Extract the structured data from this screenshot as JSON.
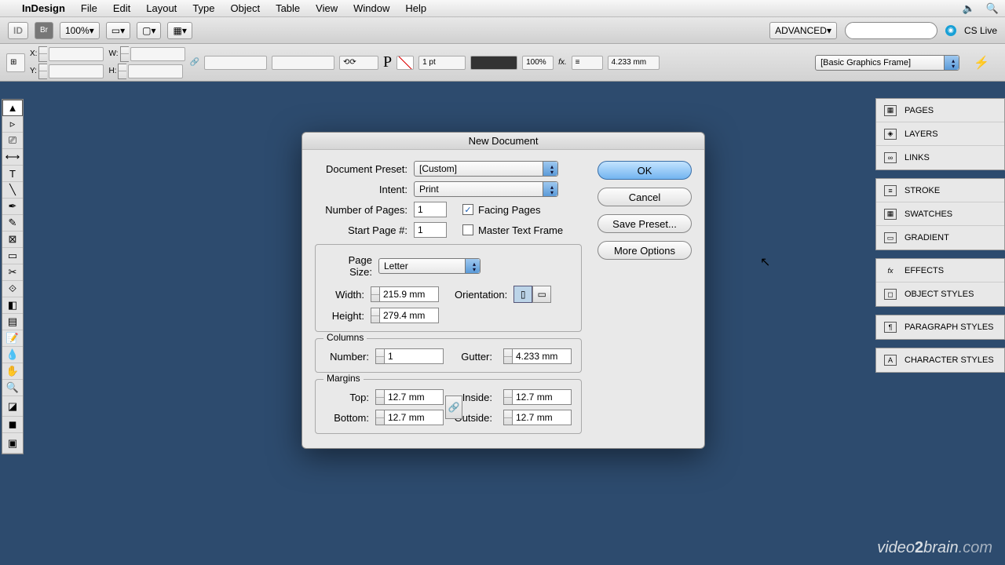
{
  "menubar": {
    "app": "InDesign",
    "items": [
      "File",
      "Edit",
      "Layout",
      "Type",
      "Object",
      "Table",
      "View",
      "Window",
      "Help"
    ]
  },
  "ctrlbar": {
    "zoom": "100%",
    "workspace": "ADVANCED",
    "cslive": "CS Live"
  },
  "propbar": {
    "x_label": "X:",
    "y_label": "Y:",
    "w_label": "W:",
    "h_label": "H:",
    "stroke": "1 pt",
    "opacity": "100%",
    "gutter": "4.233 mm",
    "frame_style": "[Basic Graphics Frame]"
  },
  "panels": {
    "g1": [
      "PAGES",
      "LAYERS",
      "LINKS"
    ],
    "g2": [
      "STROKE",
      "SWATCHES",
      "GRADIENT"
    ],
    "g3": [
      "EFFECTS",
      "OBJECT STYLES"
    ],
    "g4": [
      "PARAGRAPH STYLES"
    ],
    "g5": [
      "CHARACTER STYLES"
    ]
  },
  "dialog": {
    "title": "New Document",
    "doc_preset_label": "Document Preset:",
    "doc_preset": "[Custom]",
    "intent_label": "Intent:",
    "intent": "Print",
    "num_pages_label": "Number of Pages:",
    "num_pages": "1",
    "start_page_label": "Start Page #:",
    "start_page": "1",
    "facing_pages": "Facing Pages",
    "master_text": "Master Text Frame",
    "page_size_label": "Page Size:",
    "page_size": "Letter",
    "width_label": "Width:",
    "width": "215.9 mm",
    "height_label": "Height:",
    "height": "279.4 mm",
    "orientation_label": "Orientation:",
    "columns_legend": "Columns",
    "col_number_label": "Number:",
    "col_number": "1",
    "gutter_label": "Gutter:",
    "gutter": "4.233 mm",
    "margins_legend": "Margins",
    "top_label": "Top:",
    "top": "12.7 mm",
    "bottom_label": "Bottom:",
    "bottom": "12.7 mm",
    "inside_label": "Inside:",
    "inside": "12.7 mm",
    "outside_label": "Outside:",
    "outside": "12.7 mm",
    "ok": "OK",
    "cancel": "Cancel",
    "save_preset": "Save Preset...",
    "more_options": "More Options"
  },
  "watermark": {
    "a": "video",
    "b": "2",
    "c": "brain",
    "d": ".com"
  }
}
